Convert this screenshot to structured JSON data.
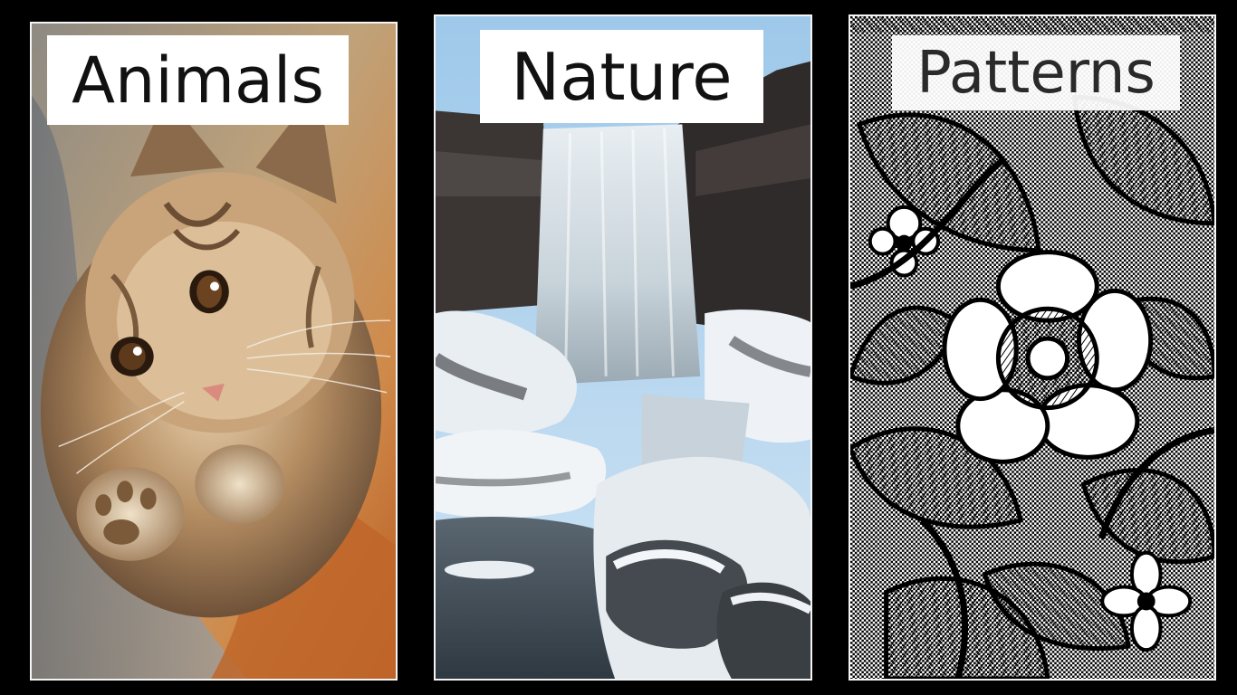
{
  "categories": [
    {
      "label": "Animals",
      "subject": "kitten"
    },
    {
      "label": "Nature",
      "subject": "waterfall"
    },
    {
      "label": "Patterns",
      "subject": "floral-line-pattern"
    }
  ],
  "colors": {
    "background": "#000000",
    "label_background": "#ffffff",
    "label_text": "#111111"
  }
}
